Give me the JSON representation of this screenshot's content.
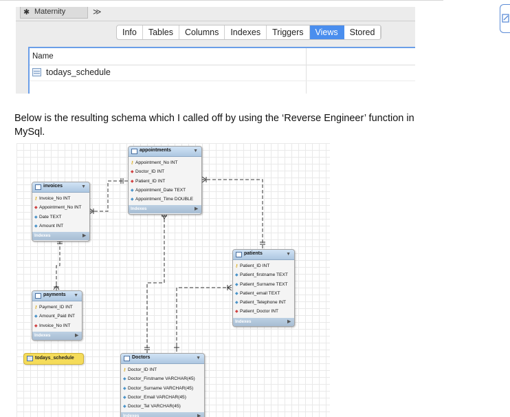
{
  "workbench": {
    "tab_title": "Maternity",
    "tab_icon": "wrench-icon",
    "more_tabs_glyph": "≫",
    "segments": [
      {
        "label": "Info",
        "active": false
      },
      {
        "label": "Tables",
        "active": false
      },
      {
        "label": "Columns",
        "active": false
      },
      {
        "label": "Indexes",
        "active": false
      },
      {
        "label": "Triggers",
        "active": false
      },
      {
        "label": "Views",
        "active": true
      },
      {
        "label": "Stored",
        "active": false
      }
    ],
    "list_header": "Name",
    "list_rows": [
      "todays_schedule"
    ]
  },
  "paragraph": "Below is the resulting schema which I called off by using the ‘Reverse Engineer’ function in MySql.",
  "diagram": {
    "indexes_label": "Indexes",
    "tables": [
      {
        "id": "appointments",
        "name": "appointments",
        "columns": [
          {
            "key": "pk",
            "text": "Appointment_No INT"
          },
          {
            "key": "fk",
            "text": "Doctor_ID INT"
          },
          {
            "key": "fk",
            "text": "Patient_ID INT"
          },
          {
            "key": "col",
            "text": "Appointment_Date TEXT"
          },
          {
            "key": "col",
            "text": "Appointment_Time DOUBLE"
          }
        ]
      },
      {
        "id": "invoices",
        "name": "invoices",
        "columns": [
          {
            "key": "pk",
            "text": "Invoice_No INT"
          },
          {
            "key": "fk",
            "text": "Appointment_No INT"
          },
          {
            "key": "col",
            "text": "Date TEXT"
          },
          {
            "key": "col",
            "text": "Amount INT"
          }
        ]
      },
      {
        "id": "patients",
        "name": "patients",
        "columns": [
          {
            "key": "pk",
            "text": "Patient_ID INT"
          },
          {
            "key": "col",
            "text": "Patient_firstname TEXT"
          },
          {
            "key": "col",
            "text": "Patient_Surname TEXT"
          },
          {
            "key": "col",
            "text": "Patient_email TEXT"
          },
          {
            "key": "col",
            "text": "Patient_Telephone INT"
          },
          {
            "key": "fk",
            "text": "Patient_Doctor INT"
          }
        ]
      },
      {
        "id": "payments",
        "name": "payments",
        "columns": [
          {
            "key": "pk",
            "text": "Payment_ID INT"
          },
          {
            "key": "col",
            "text": "Amount_Paid INT"
          },
          {
            "key": "fk",
            "text": "Invoice_No INT"
          }
        ]
      },
      {
        "id": "doctors",
        "name": "Doctors",
        "columns": [
          {
            "key": "pk",
            "text": "Doctor_ID INT"
          },
          {
            "key": "col",
            "text": "Doctor_Firstname VARCHAR(45)"
          },
          {
            "key": "col",
            "text": "Doctor_Surname VARCHAR(45)"
          },
          {
            "key": "col",
            "text": "Doctor_Email VARCHAR(45)"
          },
          {
            "key": "col",
            "text": "Doctor_Tel VARCHAR(45)"
          }
        ]
      }
    ],
    "view_name": "todays_schedule"
  },
  "colors": {
    "accent": "#4a8eee",
    "primary_key": "#d7a300",
    "foreign_key": "#d04040",
    "column": "#4a93c8",
    "view": "#f5dc5a"
  }
}
